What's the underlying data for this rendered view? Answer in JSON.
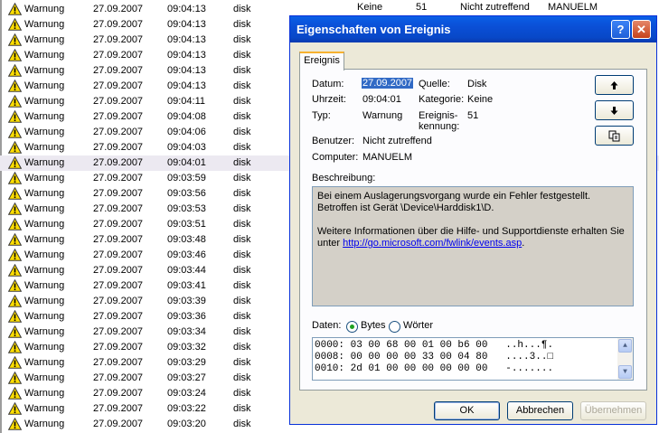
{
  "event_list": {
    "top_row": {
      "extra": [
        "Keine",
        "51",
        "Nicht zutreffend",
        "MANUELM"
      ]
    },
    "rows": [
      {
        "type": "Warnung",
        "date": "27.09.2007",
        "time": "09:04:13",
        "source": "disk"
      },
      {
        "type": "Warnung",
        "date": "27.09.2007",
        "time": "09:04:13",
        "source": "disk"
      },
      {
        "type": "Warnung",
        "date": "27.09.2007",
        "time": "09:04:13",
        "source": "disk"
      },
      {
        "type": "Warnung",
        "date": "27.09.2007",
        "time": "09:04:13",
        "source": "disk"
      },
      {
        "type": "Warnung",
        "date": "27.09.2007",
        "time": "09:04:13",
        "source": "disk"
      },
      {
        "type": "Warnung",
        "date": "27.09.2007",
        "time": "09:04:13",
        "source": "disk"
      },
      {
        "type": "Warnung",
        "date": "27.09.2007",
        "time": "09:04:11",
        "source": "disk"
      },
      {
        "type": "Warnung",
        "date": "27.09.2007",
        "time": "09:04:08",
        "source": "disk"
      },
      {
        "type": "Warnung",
        "date": "27.09.2007",
        "time": "09:04:06",
        "source": "disk"
      },
      {
        "type": "Warnung",
        "date": "27.09.2007",
        "time": "09:04:03",
        "source": "disk"
      },
      {
        "type": "Warnung",
        "date": "27.09.2007",
        "time": "09:04:01",
        "source": "disk",
        "selected": true
      },
      {
        "type": "Warnung",
        "date": "27.09.2007",
        "time": "09:03:59",
        "source": "disk"
      },
      {
        "type": "Warnung",
        "date": "27.09.2007",
        "time": "09:03:56",
        "source": "disk"
      },
      {
        "type": "Warnung",
        "date": "27.09.2007",
        "time": "09:03:53",
        "source": "disk"
      },
      {
        "type": "Warnung",
        "date": "27.09.2007",
        "time": "09:03:51",
        "source": "disk"
      },
      {
        "type": "Warnung",
        "date": "27.09.2007",
        "time": "09:03:48",
        "source": "disk"
      },
      {
        "type": "Warnung",
        "date": "27.09.2007",
        "time": "09:03:46",
        "source": "disk"
      },
      {
        "type": "Warnung",
        "date": "27.09.2007",
        "time": "09:03:44",
        "source": "disk"
      },
      {
        "type": "Warnung",
        "date": "27.09.2007",
        "time": "09:03:41",
        "source": "disk"
      },
      {
        "type": "Warnung",
        "date": "27.09.2007",
        "time": "09:03:39",
        "source": "disk"
      },
      {
        "type": "Warnung",
        "date": "27.09.2007",
        "time": "09:03:36",
        "source": "disk"
      },
      {
        "type": "Warnung",
        "date": "27.09.2007",
        "time": "09:03:34",
        "source": "disk"
      },
      {
        "type": "Warnung",
        "date": "27.09.2007",
        "time": "09:03:32",
        "source": "disk"
      },
      {
        "type": "Warnung",
        "date": "27.09.2007",
        "time": "09:03:29",
        "source": "disk"
      },
      {
        "type": "Warnung",
        "date": "27.09.2007",
        "time": "09:03:27",
        "source": "disk"
      },
      {
        "type": "Warnung",
        "date": "27.09.2007",
        "time": "09:03:24",
        "source": "disk"
      },
      {
        "type": "Warnung",
        "date": "27.09.2007",
        "time": "09:03:22",
        "source": "disk"
      },
      {
        "type": "Warnung",
        "date": "27.09.2007",
        "time": "09:03:20",
        "source": "disk"
      }
    ],
    "warning_icon": "warning-triangle-icon"
  },
  "dialog": {
    "title": "Eigenschaften von Ereignis",
    "help_glyph": "?",
    "close_glyph": "✕",
    "tab_label": "Ereignis",
    "fields": {
      "date_label": "Datum:",
      "date_value": "27.09.2007",
      "time_label": "Uhrzeit:",
      "time_value": "09:04:01",
      "type_label": "Typ:",
      "type_value": "Warnung",
      "user_label": "Benutzer:",
      "user_value": "Nicht zutreffend",
      "computer_label": "Computer:",
      "computer_value": "MANUELM",
      "source_label": "Quelle:",
      "source_value": "Disk",
      "category_label": "Kategorie:",
      "category_value": "Keine",
      "eventid_label_1": "Ereignis-",
      "eventid_label_2": "kennung:",
      "eventid_value": "51"
    },
    "nav_buttons": {
      "up_icon": "arrow-up-icon",
      "down_icon": "arrow-down-icon",
      "copy_icon": "copy-icon"
    },
    "description": {
      "label": "Beschreibung:",
      "line1": "Bei einem Auslagerungsvorgang wurde ein Fehler festgestellt. Betroffen ist Gerät \\Device\\Harddisk1\\D.",
      "line2_prefix": "Weitere Informationen über die Hilfe- und Supportdienste erhalten Sie unter ",
      "link": "http://go.microsoft.com/fwlink/events.asp",
      "line2_suffix": "."
    },
    "data": {
      "label": "Daten:",
      "radio_bytes": "Bytes",
      "radio_words": "Wörter",
      "selected": "Bytes",
      "hex_lines": [
        "0000: 03 00 68 00 01 00 b6 00   ..h...¶.",
        "0008: 00 00 00 00 33 00 04 80   ....3..□",
        "0010: 2d 01 00 00 00 00 00 00   -......."
      ]
    },
    "buttons": {
      "ok": "OK",
      "cancel": "Abbrechen",
      "apply": "Übernehmen"
    }
  }
}
